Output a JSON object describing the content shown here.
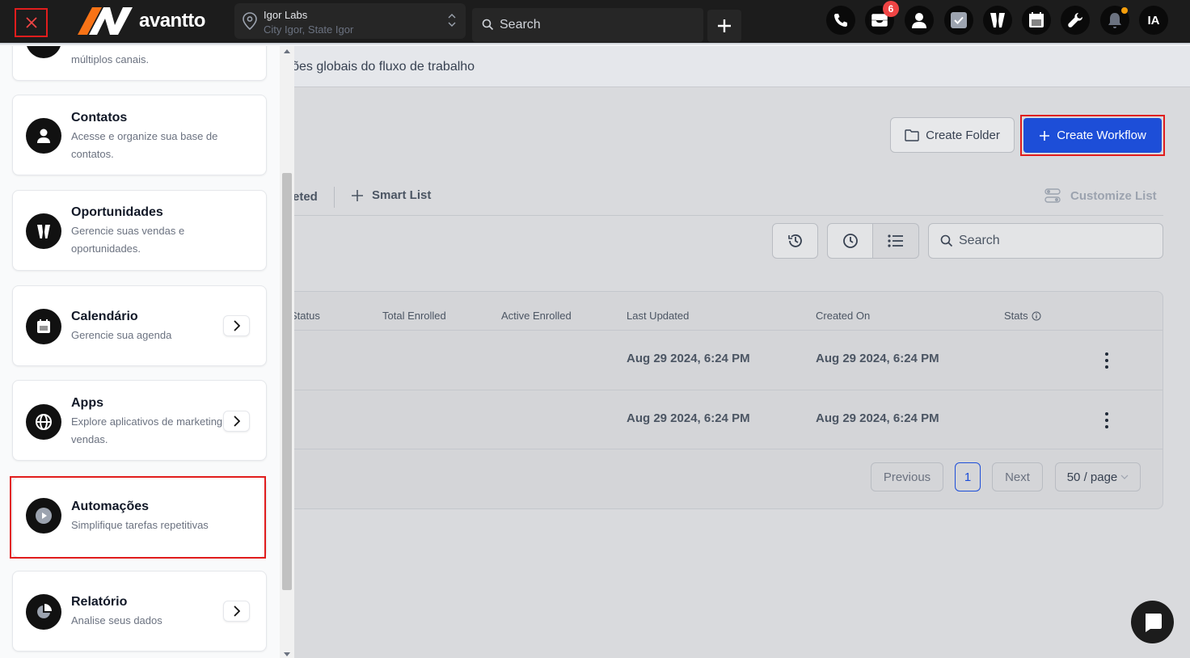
{
  "colors": {
    "accent": "#1d4ed8",
    "highlight": "#e11d1d",
    "badge": "#ef4444",
    "topbar": "#1c1c1c"
  },
  "topbar": {
    "brand": "avantto",
    "location": {
      "name": "Igor Labs",
      "address": "City Igor, State Igor"
    },
    "search_placeholder": "Search",
    "messages_badge": "6",
    "avatar_initials": "IA"
  },
  "main": {
    "subtitle_partial": "urações globais do fluxo de trabalho",
    "create_folder_label": "Create Folder",
    "create_workflow_label": "Create Workflow",
    "tab_partial": "eted",
    "smart_list_label": "Smart List",
    "customize_label": "Customize List",
    "search_placeholder": "Search",
    "table": {
      "headers": [
        "Status",
        "Total Enrolled",
        "Active Enrolled",
        "Last Updated",
        "Created On",
        "Stats"
      ],
      "rows": [
        {
          "last_updated": "Aug 29 2024, 6:24 PM",
          "created_on": "Aug 29 2024, 6:24 PM"
        },
        {
          "last_updated": "Aug 29 2024, 6:24 PM",
          "created_on": "Aug 29 2024, 6:24 PM"
        }
      ]
    },
    "pagination": {
      "previous": "Previous",
      "page": "1",
      "next": "Next",
      "page_size": "50 / page"
    }
  },
  "sidebar": {
    "items": [
      {
        "title": "",
        "desc": "múltiplos canais.",
        "icon": "chat-icon"
      },
      {
        "title": "Contatos",
        "desc": "Acesse e organize sua base de contatos.",
        "icon": "user-icon"
      },
      {
        "title": "Oportunidades",
        "desc": "Gerencie suas vendas e oportunidades.",
        "icon": "funnel-icon"
      },
      {
        "title": "Calendário",
        "desc": "Gerencie sua agenda",
        "icon": "calendar-icon"
      },
      {
        "title": "Apps",
        "desc": "Explore aplicativos de marketing e vendas.",
        "icon": "globe-icon"
      },
      {
        "title": "Automações",
        "desc": "Simplifique tarefas repetitivas",
        "icon": "play-icon"
      },
      {
        "title": "Relatório",
        "desc": "Analise seus dados",
        "icon": "pie-chart-icon"
      }
    ]
  }
}
